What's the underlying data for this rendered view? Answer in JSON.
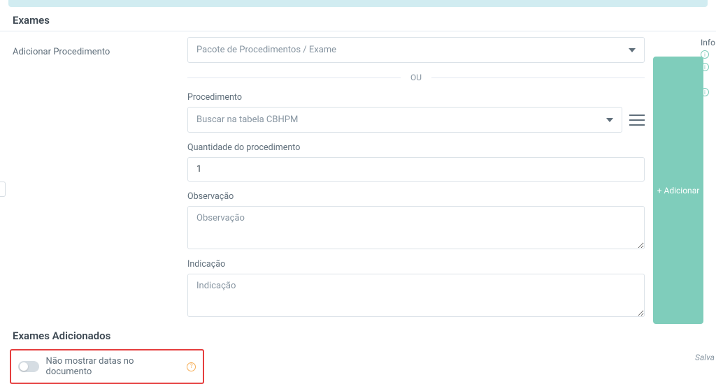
{
  "sections": {
    "exams_title": "Exames",
    "added_title": "Exames Adicionados"
  },
  "labels": {
    "add_procedure": "Adicionar Procedimento",
    "procedure": "Procedimento",
    "quantity": "Quantidade do procedimento",
    "observation": "Observação",
    "indication": "Indicação",
    "separator": "OU",
    "hide_dates": "Não mostrar datas no documento",
    "info": "Info"
  },
  "placeholders": {
    "package": "Pacote de Procedimentos / Exame",
    "cbhpm": "Buscar na tabela CBHPM",
    "observation": "Observação",
    "indication": "Indicação"
  },
  "values": {
    "quantity": "1"
  },
  "buttons": {
    "add": "+  Adicionar"
  },
  "footer": {
    "save_hint": "Salva"
  }
}
